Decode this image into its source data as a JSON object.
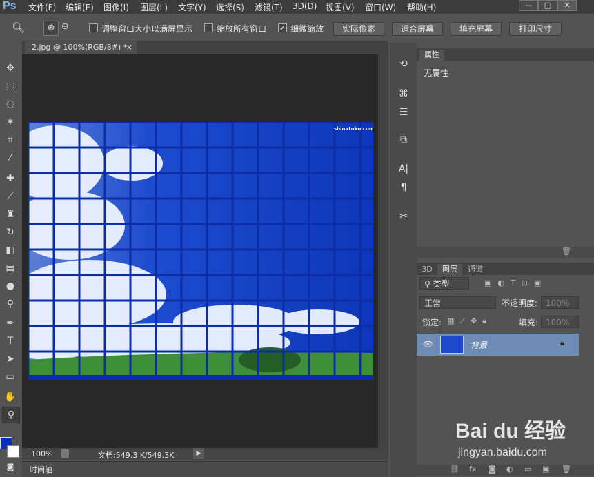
{
  "app": {
    "logo": "Ps"
  },
  "menu": [
    "文件(F)",
    "编辑(E)",
    "图像(I)",
    "图层(L)",
    "文字(Y)",
    "选择(S)",
    "滤镜(T)",
    "3D(D)",
    "视图(V)",
    "窗口(W)",
    "帮助(H)"
  ],
  "window_buttons": [
    "—",
    "□",
    "✕"
  ],
  "options": {
    "checkbox1": "调整窗口大小以满屏显示",
    "checkbox2": "缩放所有窗口",
    "checkbox3": "细微缩放",
    "btn_actual": "实际像素",
    "btn_fit": "适合屏幕",
    "btn_fill": "填充屏幕",
    "btn_print": "打印尺寸"
  },
  "document": {
    "tab": "2.jpg @ 100%(RGB/8#) *",
    "watermark": "shinatuku.com",
    "zoom": "100%",
    "doc_size": "文档:549.3 K/549.3K"
  },
  "timeline": {
    "label": "时间轴"
  },
  "properties": {
    "tab": "属性",
    "content": "无属性"
  },
  "layers": {
    "tabs": [
      "3D",
      "图层",
      "通道"
    ],
    "filter": "类型",
    "blend": "正常",
    "opacity_label": "不透明度:",
    "opacity_value": "100%",
    "lock_label": "锁定:",
    "fill_label": "填充:",
    "fill_value": "100%",
    "layer_name": "背景"
  },
  "colors": {
    "foreground": "#0a2fb5",
    "background": "#ffffff"
  },
  "footer_watermark": {
    "brand": "Bai du 经验",
    "url": "jingyan.baidu.com"
  }
}
